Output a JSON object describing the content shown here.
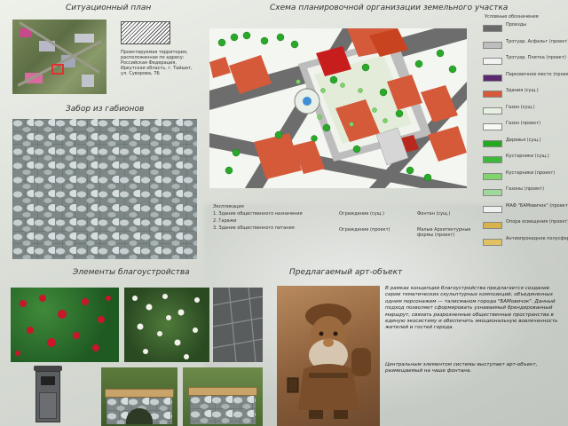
{
  "situation": {
    "title": "Ситуационный план",
    "address": "Проектируемая территория, расположенная по адресу: Российская Федерация, Иркутская область, г. Тайшет, ул. Суворова, 7Б"
  },
  "gabion": {
    "title": "Забор из габионов"
  },
  "scheme": {
    "title": "Схема планировочной организации земельного участка",
    "explication": {
      "title": "Экспликация",
      "items": [
        "1. Здание общественного назначения",
        "2. Гаражи",
        "3. Здание общественного питания"
      ]
    },
    "notes": {
      "fence_existing": "Ограждение (сущ.)",
      "fence_project": "Ограждение (проект)",
      "fountain": "Фонтан (сущ.)",
      "maf": "Малые Архитектурные формы (проект)"
    }
  },
  "legend": {
    "title": "Условные обозначения",
    "items": [
      {
        "label": "Проезды",
        "color": "#6a6a6a"
      },
      {
        "label": "Тротуар. Асфальт (проект)",
        "color": "#bdbdbd"
      },
      {
        "label": "Тротуар. Плитка (проект)",
        "color": "#f2f2f2"
      },
      {
        "label": "Парковочное место (проект)",
        "color": "#5b2a6e"
      },
      {
        "label": "Здания (сущ.)",
        "color": "#d45a3a"
      },
      {
        "label": "Газон (сущ.)",
        "color": "#e6efe0"
      },
      {
        "label": "Газон (проект)",
        "color": "#f7faf4"
      },
      {
        "label": "Деревья (сущ.)",
        "color": "#27a821"
      },
      {
        "label": "Кустарники (сущ.)",
        "color": "#3cb83a"
      },
      {
        "label": "Кустарники (проект)",
        "color": "#7fd46b"
      },
      {
        "label": "Газоны (проект)",
        "color": "#9fd89a"
      },
      {
        "label": "МАФ \"БАМовичок\" (проект)",
        "color": "#f0f0f0"
      },
      {
        "label": "Опора освещения (проект)",
        "color": "#d8b24a"
      },
      {
        "label": "Антиопрокидное полусферы (проект)",
        "color": "#e0c060"
      }
    ]
  },
  "elements": {
    "title": "Элементы благоустройства"
  },
  "art": {
    "title": "Предлагаемый арт-объект",
    "paragraph1": "В рамках концепции благоустройства предлагается создание серии тематических скульптурных композиций, объединенных одним персонажем — талисманом города \"БАМовичок\". Данный подход позволяет сформировать узнаваемый брендированный маршрут, связать разрозненные общественные пространства в единую экосистему и обеспечить эмоциональную вовлеченность жителей и гостей города.",
    "paragraph2": "Центральным элементом системы выступает арт-объект, размещаемый на чаше фонтана."
  }
}
